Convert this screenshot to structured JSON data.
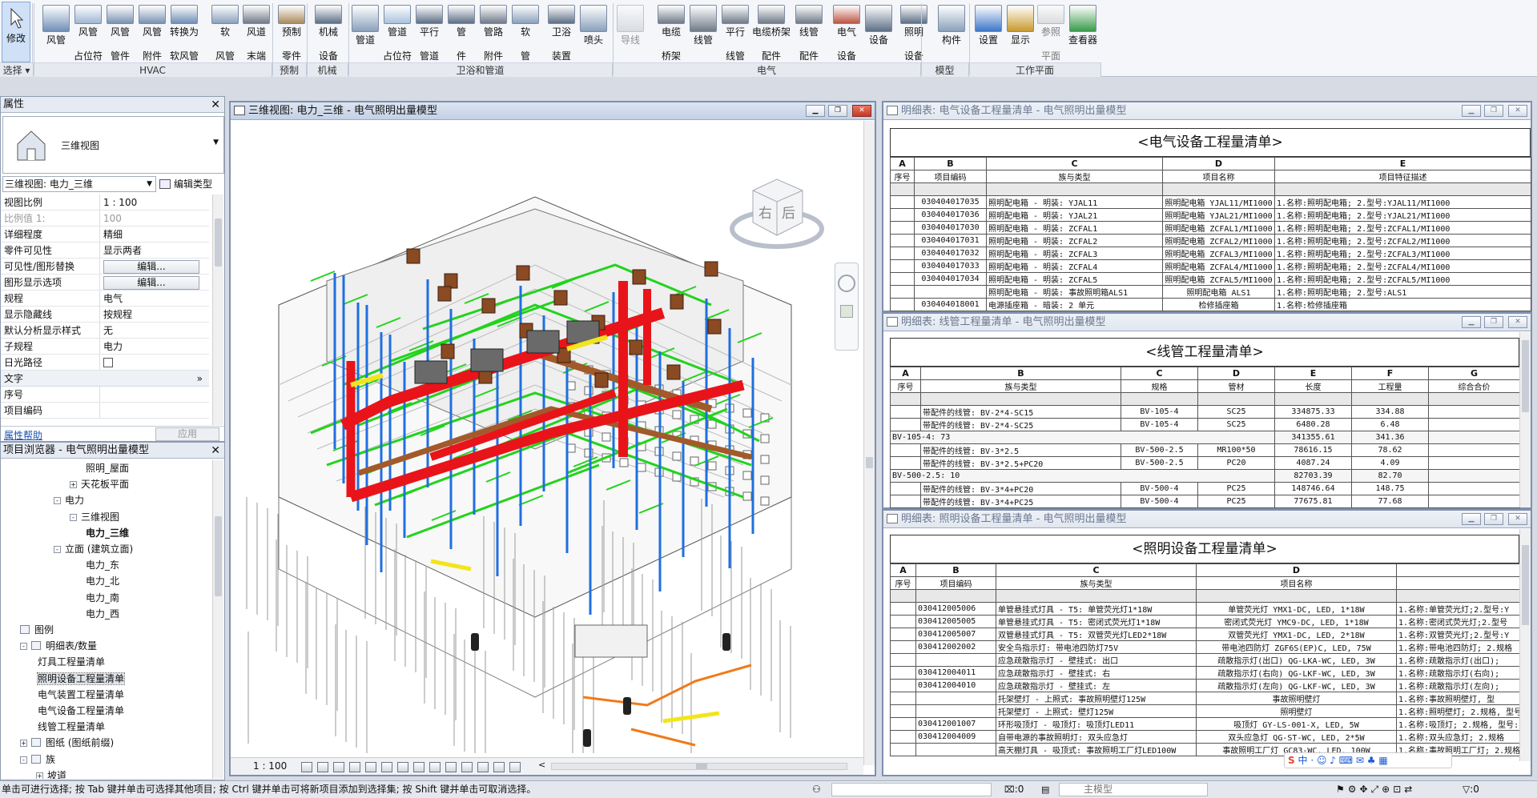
{
  "ribbon": {
    "modify_label": "修改",
    "panels": [
      {
        "name": "选择",
        "foot": "选择 ▾"
      },
      {
        "name": "HVAC",
        "foot": "HVAC"
      },
      {
        "name": "预制",
        "foot": "预制"
      },
      {
        "name": "机械",
        "foot": "机械"
      },
      {
        "name": "卫浴和管道",
        "foot": "卫浴和管道"
      },
      {
        "name": "电气",
        "foot": "电气"
      },
      {
        "name": "模型",
        "foot": "模型"
      },
      {
        "name": "工作平面",
        "foot": "工作平面"
      }
    ],
    "buttons": [
      {
        "l1": "风管",
        "l2": ""
      },
      {
        "l1": "风管",
        "l2": "占位符"
      },
      {
        "l1": "风管",
        "l2": "管件"
      },
      {
        "l1": "风管",
        "l2": "附件"
      },
      {
        "l1": "转换为",
        "l2": "软风管"
      },
      {
        "l1": "软",
        "l2": "风管"
      },
      {
        "l1": "风道",
        "l2": "末端"
      },
      {
        "l1": "预制",
        "l2": "零件"
      },
      {
        "l1": "机械",
        "l2": "设备"
      },
      {
        "l1": "管道",
        "l2": ""
      },
      {
        "l1": "管道",
        "l2": "占位符"
      },
      {
        "l1": "平行",
        "l2": "管道"
      },
      {
        "l1": "管",
        "l2": "件"
      },
      {
        "l1": "管路",
        "l2": "附件"
      },
      {
        "l1": "软",
        "l2": "管"
      },
      {
        "l1": "卫浴",
        "l2": "装置"
      },
      {
        "l1": "喷头",
        "l2": ""
      },
      {
        "l1": "导线",
        "l2": ""
      },
      {
        "l1": "电缆",
        "l2": "桥架"
      },
      {
        "l1": "线管",
        "l2": ""
      },
      {
        "l1": "平行",
        "l2": "线管"
      },
      {
        "l1": "电缆桥架",
        "l2": "配件"
      },
      {
        "l1": "线管",
        "l2": "配件"
      },
      {
        "l1": "电气",
        "l2": "设备"
      },
      {
        "l1": "设备",
        "l2": ""
      },
      {
        "l1": "照明",
        "l2": "设备"
      },
      {
        "l1": "构件",
        "l2": ""
      },
      {
        "l1": "设置",
        "l2": ""
      },
      {
        "l1": "显示",
        "l2": ""
      },
      {
        "l1": "参照",
        "l2": "平面"
      },
      {
        "l1": "查看器",
        "l2": ""
      }
    ]
  },
  "properties": {
    "title": "属性",
    "type_name": "三维视图",
    "view_selector": "三维视图: 电力_三维",
    "edit_type": "编辑类型",
    "rows": [
      {
        "k": "视图比例",
        "v": "1 : 100"
      },
      {
        "k": "比例值 1:",
        "v": "100"
      },
      {
        "k": "详细程度",
        "v": "精细"
      },
      {
        "k": "零件可见性",
        "v": "显示两者"
      },
      {
        "k": "可见性/图形替换",
        "v": "编辑..."
      },
      {
        "k": "图形显示选项",
        "v": "编辑..."
      },
      {
        "k": "规程",
        "v": "电气"
      },
      {
        "k": "显示隐藏线",
        "v": "按规程"
      },
      {
        "k": "默认分析显示样式",
        "v": "无"
      },
      {
        "k": "子规程",
        "v": "电力"
      },
      {
        "k": "日光路径",
        "v": ""
      }
    ],
    "group_text": "文字",
    "rows2": [
      {
        "k": "序号",
        "v": ""
      },
      {
        "k": "项目编码",
        "v": ""
      }
    ],
    "help": "属性帮助",
    "apply": "应用"
  },
  "browser": {
    "title": "项目浏览器 - 电气照明出量模型",
    "nodes": [
      {
        "t": "照明_屋面",
        "bold": false
      },
      {
        "t": "天花板平面",
        "bold": false
      },
      {
        "t": "电力",
        "bold": false
      },
      {
        "t": "三维视图",
        "bold": false
      },
      {
        "t": "电力_三维",
        "bold": true
      },
      {
        "t": "立面 (建筑立面)",
        "bold": false
      },
      {
        "t": "电力_东",
        "bold": false
      },
      {
        "t": "电力_北",
        "bold": false
      },
      {
        "t": "电力_南",
        "bold": false
      },
      {
        "t": "电力_西",
        "bold": false
      },
      {
        "t": "图例",
        "bold": false
      },
      {
        "t": "明细表/数量",
        "bold": false
      },
      {
        "t": "灯具工程量清单",
        "bold": false
      },
      {
        "t": "照明设备工程量清单",
        "bold": false
      },
      {
        "t": "电气装置工程量清单",
        "bold": false
      },
      {
        "t": "电气设备工程量清单",
        "bold": false
      },
      {
        "t": "线管工程量清单",
        "bold": false
      },
      {
        "t": "图纸 (图纸前缀)",
        "bold": false
      },
      {
        "t": "族",
        "bold": false
      },
      {
        "t": "坡道",
        "bold": false
      }
    ]
  },
  "view3d": {
    "title": "三维视图: 电力_三维 - 电气照明出量模型",
    "scale": "1 : 100",
    "cube_left": "右",
    "cube_right": "后",
    "colors": {
      "red": "#e8141a",
      "green": "#22d31c",
      "blue": "#1f6fe0",
      "brown": "#a25a2a",
      "yellow": "#f2e51a",
      "orange": "#f07a1a"
    }
  },
  "sched1": {
    "title": "明细表: 电气设备工程量清单 - 电气照明出量模型",
    "heading": "<电气设备工程量清单>",
    "letters": [
      "A",
      "B",
      "C",
      "D",
      "E"
    ],
    "headers": [
      "序号",
      "项目编码",
      "族与类型",
      "项目名称",
      "项目特征描述"
    ],
    "rows": [
      [
        "",
        "",
        "",
        "",
        ""
      ],
      [
        "",
        "030404017035",
        "照明配电箱 - 明装: YJAL11",
        "照明配电箱 YJAL11/MI1000",
        "1.名称:照明配电箱; 2.型号:YJAL11/MI1000"
      ],
      [
        "",
        "030404017036",
        "照明配电箱 - 明装: YJAL21",
        "照明配电箱 YJAL21/MI1000",
        "1.名称:照明配电箱; 2.型号:YJAL21/MI1000"
      ],
      [
        "",
        "030404017030",
        "照明配电箱 - 明装: ZCFAL1",
        "照明配电箱 ZCFAL1/MI1000",
        "1.名称:照明配电箱; 2.型号:ZCFAL1/MI1000"
      ],
      [
        "",
        "030404017031",
        "照明配电箱 - 明装: ZCFAL2",
        "照明配电箱 ZCFAL2/MI1000",
        "1.名称:照明配电箱; 2.型号:ZCFAL2/MI1000"
      ],
      [
        "",
        "030404017032",
        "照明配电箱 - 明装: ZCFAL3",
        "照明配电箱 ZCFAL3/MI1000",
        "1.名称:照明配电箱; 2.型号:ZCFAL3/MI1000"
      ],
      [
        "",
        "030404017033",
        "照明配电箱 - 明装: ZCFAL4",
        "照明配电箱 ZCFAL4/MI1000",
        "1.名称:照明配电箱; 2.型号:ZCFAL4/MI1000"
      ],
      [
        "",
        "030404017034",
        "照明配电箱 - 明装: ZCFAL5",
        "照明配电箱 ZCFAL5/MI1000",
        "1.名称:照明配电箱; 2.型号:ZCFAL5/MI1000"
      ],
      [
        "",
        "",
        "照明配电箱 - 明装: 事故照明箱ALS1",
        "照明配电箱 ALS1",
        "1.名称:照明配电箱; 2.型号:ALS1"
      ],
      [
        "",
        "030404018001",
        "电源插座箱 - 暗装: 2 单元",
        "检修插座箱",
        "1.名称:检修插座箱"
      ]
    ]
  },
  "sched2": {
    "title": "明细表: 线管工程量清单 - 电气照明出量模型",
    "heading": "<线管工程量清单>",
    "letters": [
      "A",
      "B",
      "C",
      "D",
      "E",
      "F",
      "G"
    ],
    "headers": [
      "序号",
      "族与类型",
      "规格",
      "管材",
      "长度",
      "工程量",
      "综合合价"
    ],
    "rows": [
      {
        "g": false,
        "c": [
          "",
          "",
          "",
          "",
          "",
          "",
          ""
        ]
      },
      {
        "g": false,
        "c": [
          "",
          "带配件的线管: BV-2*4-SC15",
          "BV-105-4",
          "SC25",
          "334875.33",
          "334.88",
          ""
        ]
      },
      {
        "g": false,
        "c": [
          "",
          "带配件的线管: BV-2*4-SC25",
          "BV-105-4",
          "SC25",
          "6480.28",
          "6.48",
          ""
        ]
      },
      {
        "g": true,
        "c": [
          "BV-105-4: 73",
          "",
          "",
          "",
          "341355.61",
          "341.36",
          ""
        ]
      },
      {
        "g": false,
        "c": [
          "",
          "带配件的线管: BV-3*2.5",
          "BV-500-2.5",
          "MR100*50",
          "78616.15",
          "78.62",
          ""
        ]
      },
      {
        "g": false,
        "c": [
          "",
          "带配件的线管: BV-3*2.5+PC20",
          "BV-500-2.5",
          "PC20",
          "4087.24",
          "4.09",
          ""
        ]
      },
      {
        "g": true,
        "c": [
          "BV-500-2.5: 10",
          "",
          "",
          "",
          "82703.39",
          "82.70",
          ""
        ]
      },
      {
        "g": false,
        "c": [
          "",
          "带配件的线管: BV-3*4+PC20",
          "BV-500-4",
          "PC25",
          "148746.64",
          "148.75",
          ""
        ]
      },
      {
        "g": false,
        "c": [
          "",
          "带配件的线管: BV-3*4+PC25",
          "BV-500-4",
          "PC25",
          "77675.81",
          "77.68",
          ""
        ]
      }
    ]
  },
  "sched3": {
    "title": "明细表: 照明设备工程量清单 - 电气照明出量模型",
    "heading": "<照明设备工程量清单>",
    "letters": [
      "A",
      "B",
      "C",
      "D",
      ""
    ],
    "headers": [
      "序号",
      "项目编码",
      "族与类型",
      "项目名称",
      ""
    ],
    "rows": [
      [
        "",
        "",
        "",
        "",
        ""
      ],
      [
        "",
        "030412005006",
        "单管悬挂式灯具 - T5: 单管荧光灯1*18W",
        "单管荧光灯 YMX1-DC, LED, 1*18W",
        "1.名称:单管荧光灯;2.型号:Y"
      ],
      [
        "",
        "030412005005",
        "单管悬挂式灯具 - T5: 密闭式荧光灯1*18W",
        "密闭式荧光灯 YMC9-DC, LED, 1*18W",
        "1.名称:密闭式荧光灯;2.型号"
      ],
      [
        "",
        "030412005007",
        "双管悬挂式灯具 - T5: 双管荧光灯LED2*18W",
        "双管荧光灯 YMX1-DC, LED, 2*18W",
        "1.名称:双管荧光灯;2.型号:Y"
      ],
      [
        "",
        "030412002002",
        "安全鸟指示灯: 带电池四防灯75V",
        "带电池四防灯 ZGF6S(EP)C, LED, 75W",
        "1.名称:带电池四防灯; 2.规格"
      ],
      [
        "",
        "",
        "应急疏散指示灯 - 壁挂式: 出口",
        "疏散指示灯(出口) QG-LKA-WC, LED, 3W",
        "1.名称:疏散指示灯(出口);"
      ],
      [
        "",
        "030412004011",
        "应急疏散指示灯 - 壁挂式: 右",
        "疏散指示灯(右向) QG-LKF-WC, LED, 3W",
        "1.名称:疏散指示灯(右向);"
      ],
      [
        "",
        "030412004010",
        "应急疏散指示灯 - 壁挂式: 左",
        "疏散指示灯(左向) QG-LKF-WC, LED, 3W",
        "1.名称:疏散指示灯(左向);"
      ],
      [
        "",
        "",
        "托架壁灯 - 上照式: 事故照明壁灯125W",
        "事故照明壁灯",
        "1.名称:事故照明壁灯, 型"
      ],
      [
        "",
        "",
        "托架壁灯 - 上照式: 壁灯125W",
        "照明壁灯",
        "1.名称:照明壁灯; 2.规格, 型号:"
      ],
      [
        "",
        "030412001007",
        "环形吸顶灯 - 吸顶灯: 吸顶灯LED11",
        "吸顶灯 GY-LS-001-X, LED, 5W",
        "1.名称:吸顶灯; 2.规格, 型号:"
      ],
      [
        "",
        "030412004009",
        "自带电源的事故照明灯: 双头应急灯",
        "双头应急灯 QG-ST-WC, LED, 2*5W",
        "1.名称:双头应急灯; 2.规格"
      ],
      [
        "",
        "",
        "高天棚灯具 - 吸顶式: 事故照明工厂灯LED100W",
        "事故照明工厂灯 GC83-WC, LED, 100W",
        "1.名称:事故照明工厂灯; 2.规格"
      ]
    ]
  },
  "status": {
    "hint": "单击可进行选择; 按 Tab 键并单击可选择其他项目; 按 Ctrl 键并单击可将新项目添加到选择集; 按 Shift 键并单击可取消选择。",
    "zero1": ":0",
    "model": "主模型",
    "filter": ":0",
    "ime_lang": "中"
  }
}
